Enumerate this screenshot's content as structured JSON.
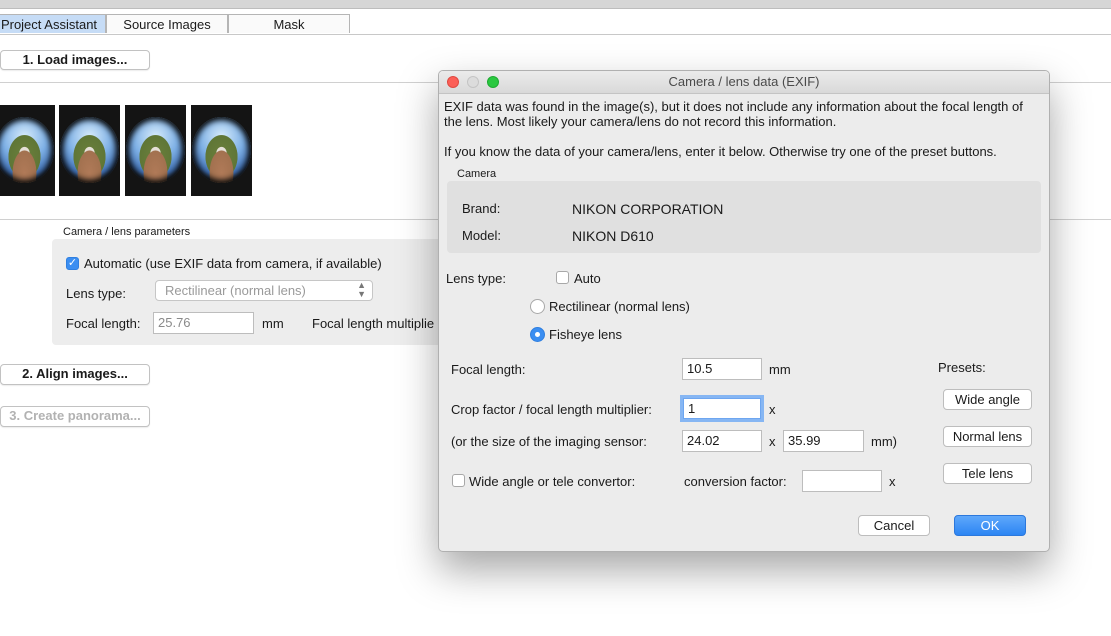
{
  "tabs": [
    {
      "label": "Project Assistant",
      "active": true
    },
    {
      "label": "Source Images",
      "active": false
    },
    {
      "label": "Mask",
      "active": false
    }
  ],
  "main": {
    "load_button": "1. Load images...",
    "thumbnail_count": 4,
    "group_title": "Camera / lens parameters",
    "auto_label": "Automatic (use EXIF data from camera, if available)",
    "auto_checked": true,
    "lens_type_label": "Lens type:",
    "lens_type_value": "Rectilinear (normal lens)",
    "focal_length_label": "Focal length:",
    "focal_length_value": "25.76",
    "focal_length_unit": "mm",
    "multiplier_label": "Focal length multiplie",
    "align_button": "2. Align images...",
    "create_button": "3. Create panorama..."
  },
  "dialog": {
    "title": "Camera / lens data (EXIF)",
    "message1": "EXIF data was found in the image(s), but it does not include any information about the focal length of the lens. Most likely your camera/lens do not record this information.",
    "message2": "If you know the data of your camera/lens, enter it below. Otherwise try one of the preset buttons.",
    "camera_title": "Camera",
    "brand_label": "Brand:",
    "brand_value": "NIKON CORPORATION",
    "model_label": "Model:",
    "model_value": "NIKON D610",
    "lens_type_label": "Lens type:",
    "auto_label": "Auto",
    "rectilinear_label": "Rectilinear (normal lens)",
    "fisheye_label": "Fisheye lens",
    "selected_lens": "Fisheye lens",
    "focal_length_label": "Focal length:",
    "focal_length_value": "10.5",
    "focal_unit": "mm",
    "crop_label": "Crop factor / focal length multiplier:",
    "crop_value": "1",
    "crop_unit": "x",
    "sensor_label": "(or the size of the imaging sensor:",
    "sensor_width": "24.02",
    "sensor_x": "x",
    "sensor_height": "35.99",
    "sensor_unit": "mm)",
    "convertor_label": "Wide angle or tele convertor:",
    "conversion_label": "conversion factor:",
    "conversion_value": "",
    "conversion_unit": "x",
    "presets_label": "Presets:",
    "preset_wide": "Wide angle",
    "preset_normal": "Normal lens",
    "preset_tele": "Tele lens",
    "cancel_button": "Cancel",
    "ok_button": "OK"
  },
  "colors": {
    "accent": "#2c85f3",
    "tab_active": "#c6dcf6",
    "close": "#fc5f57",
    "minimize": "#dcdcdc",
    "zoom": "#2ac840"
  }
}
